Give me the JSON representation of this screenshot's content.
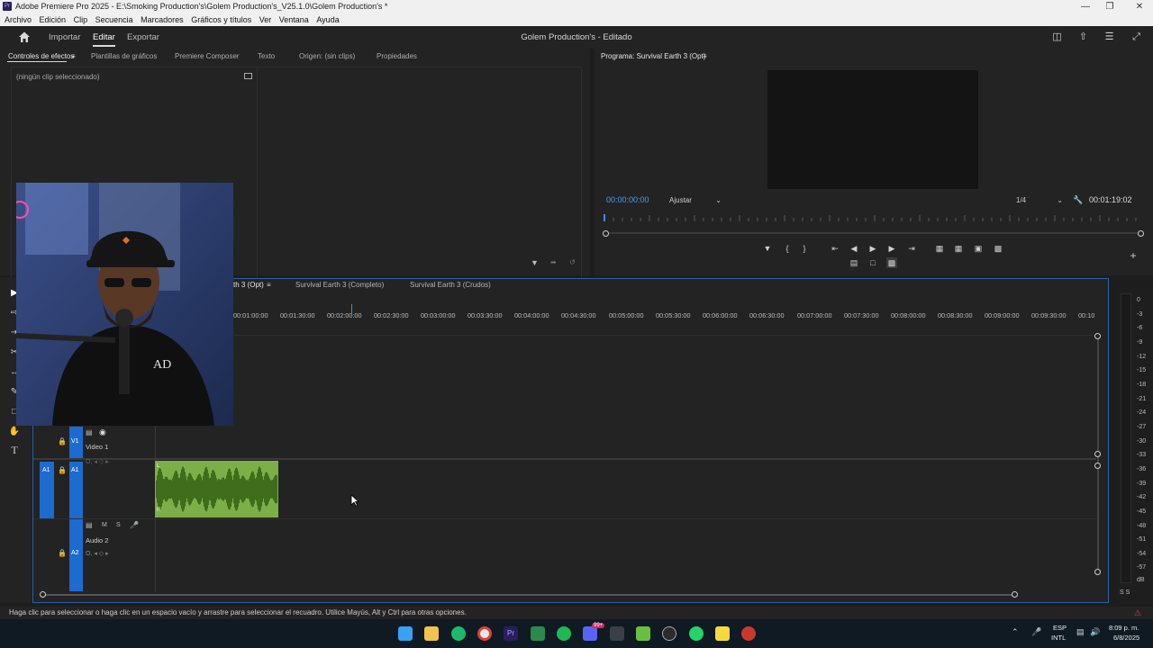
{
  "window": {
    "title": "Adobe Premiere Pro 2025 - E:\\Smoking Production's\\Golem Production's_V25.1.0\\Golem Production's *",
    "app_badge": "Pr"
  },
  "menu": [
    "Archivo",
    "Edición",
    "Clip",
    "Secuencia",
    "Marcadores",
    "Gráficos y títulos",
    "Ver",
    "Ventana",
    "Ayuda"
  ],
  "topbar": {
    "nav": [
      "Importar",
      "Editar",
      "Exportar"
    ],
    "active": "Editar",
    "project_title": "Golem Production's - Editado"
  },
  "left_panel": {
    "tabs": [
      "Controles de efectos",
      "Plantillas de gráficos",
      "Premiere Composer",
      "Texto",
      "Origen: (sin clips)",
      "Propiedades"
    ],
    "no_clip": "(ningún clip seleccionado)"
  },
  "program": {
    "tab": "Programa: Survival Earth 3 (Opt)",
    "timecode_in": "00:00:00:00",
    "fit": "Ajustar",
    "resolution": "1/4",
    "duration": "00:01:19:02"
  },
  "timeline": {
    "tabs": [
      "Survival Earth 3 (Opt)",
      "Survival Earth 3 (Completo)",
      "Survival Earth 3 (Crudos)"
    ],
    "visible_first_tab": "th 3 (Opt)",
    "ruler": [
      "00:01:00:00",
      "00:01:30:00",
      "00:02:00:00",
      "00:02:30:00",
      "00:03:00:00",
      "00:03:30:00",
      "00:04:00:00",
      "00:04:30:00",
      "00:05:00:00",
      "00:05:30:00",
      "00:06:00:00",
      "00:06:30:00",
      "00:07:00:00",
      "00:07:30:00",
      "00:08:00:00",
      "00:08:30:00",
      "00:09:00:00",
      "00:09:30:00",
      "00:10"
    ],
    "tracks": {
      "v1": {
        "label": "V1",
        "name": "Video 1"
      },
      "a1": {
        "label": "A1",
        "source": "A1"
      },
      "a2": {
        "label": "A2",
        "name": "Audio 2"
      },
      "a1_m": "M",
      "a1_s": "S"
    },
    "clip_marks": {
      "left": "L",
      "right": "R"
    }
  },
  "vu_scale": [
    "0",
    "-3",
    "-6",
    "-9",
    "-12",
    "-15",
    "-18",
    "-21",
    "-24",
    "-27",
    "-30",
    "-33",
    "-36",
    "-39",
    "-42",
    "-45",
    "-48",
    "-51",
    "-54",
    "-57",
    "dB"
  ],
  "vu_bottom": "S S",
  "status": "Haga clic para seleccionar o haga clic en un espacio vacío y arrastre para seleccionar el recuadro. Utilice Mayús, Alt y Ctrl para otras opciones.",
  "taskbar": {
    "lang1": "ESP",
    "lang2": "INTL",
    "time": "8:09 p. m.",
    "date": "6/8/2025",
    "discord_badge": "99+"
  },
  "colors": {
    "accent": "#1d6bd0",
    "timecode": "#4d9bf5",
    "audio_clip": "#6c9f3a",
    "panel_bg": "#232323"
  }
}
